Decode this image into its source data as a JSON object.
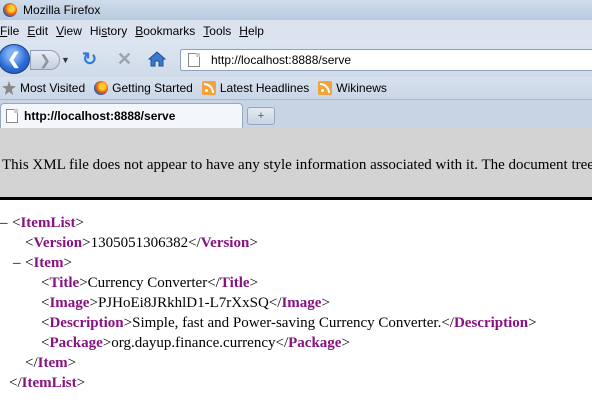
{
  "window": {
    "title": "Mozilla Firefox",
    "logo_icon": "firefox-logo-icon"
  },
  "menubar": {
    "items": [
      {
        "label": "File",
        "accel": "F"
      },
      {
        "label": "Edit",
        "accel": "E"
      },
      {
        "label": "View",
        "accel": "V"
      },
      {
        "label": "History",
        "accel": "s"
      },
      {
        "label": "Bookmarks",
        "accel": "B"
      },
      {
        "label": "Tools",
        "accel": "T"
      },
      {
        "label": "Help",
        "accel": "H"
      }
    ]
  },
  "navbar": {
    "url": "http://localhost:8888/serve",
    "back_icon": "back-arrow-icon",
    "forward_icon": "forward-arrow-icon",
    "reload_icon": "reload-icon",
    "stop_icon": "stop-icon",
    "home_icon": "home-icon"
  },
  "bookmarks": {
    "items": [
      {
        "label": "Most Visited",
        "icon": "star-icon"
      },
      {
        "label": "Getting Started",
        "icon": "firefox-icon"
      },
      {
        "label": "Latest Headlines",
        "icon": "rss-icon"
      },
      {
        "label": "Wikinews",
        "icon": "rss-icon"
      }
    ]
  },
  "tabs": {
    "active_label": "http://localhost:8888/serve",
    "new_tab_symbol": "+"
  },
  "content": {
    "banner": "This XML file does not appear to have any style information associated with it. The document tree is shown below.",
    "xml": {
      "root": "ItemList",
      "version_tag": "Version",
      "version": "1305051306382",
      "item_tag": "Item",
      "title_tag": "Title",
      "title": "Currency Converter",
      "image_tag": "Image",
      "image": "PJHoEi8JRkhlD1-L7rXxSQ",
      "description_tag": "Description",
      "description": "Simple, fast and Power-saving Currency Converter.",
      "package_tag": "Package",
      "package": "org.dayup.finance.currency"
    }
  },
  "colors": {
    "xml_tag": "#881280",
    "banner_bg": "#d3d3d3"
  }
}
